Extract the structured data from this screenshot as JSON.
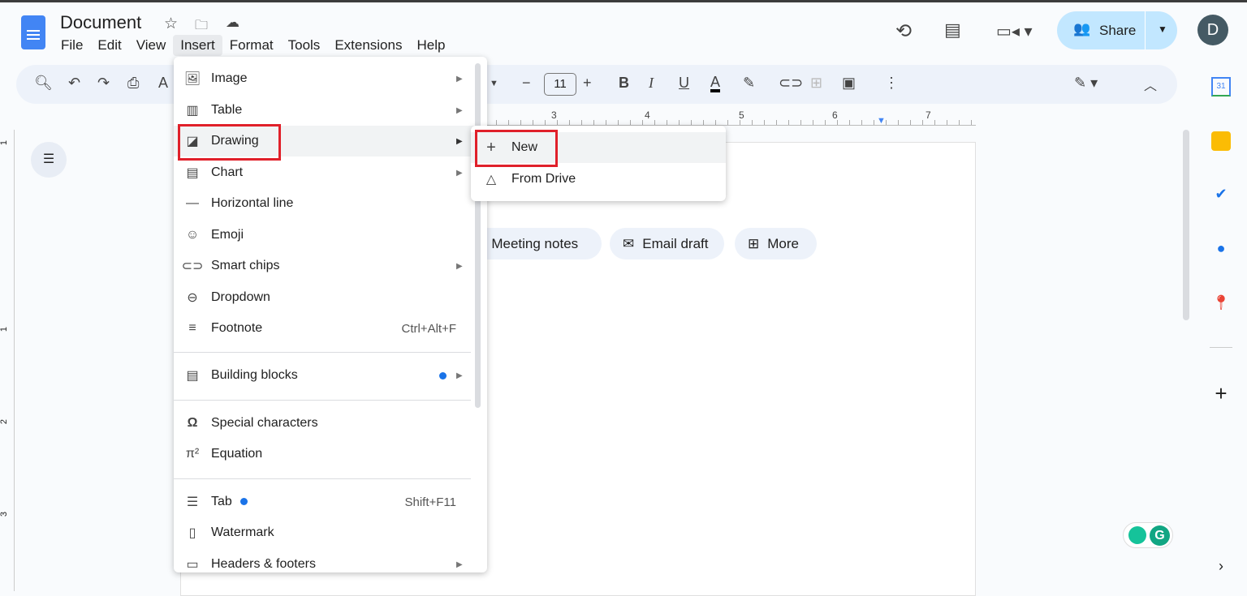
{
  "header": {
    "title": "Document",
    "avatar_letter": "D",
    "share_label": "Share"
  },
  "menubar": [
    "File",
    "Edit",
    "View",
    "Insert",
    "Format",
    "Tools",
    "Extensions",
    "Help"
  ],
  "toolbar": {
    "font_size": "11"
  },
  "ruler": {
    "labels": [
      "3",
      "4",
      "5",
      "6",
      "7"
    ],
    "vertical_labels": [
      "1",
      "1",
      "2",
      "3"
    ]
  },
  "chips": [
    {
      "label": "Meeting notes"
    },
    {
      "label": "Email draft"
    },
    {
      "label": "More"
    }
  ],
  "insert_menu": {
    "items": [
      {
        "label": "Image",
        "icon": "image-icon",
        "submenu": true
      },
      {
        "label": "Table",
        "icon": "table-icon",
        "submenu": true
      },
      {
        "label": "Drawing",
        "icon": "drawing-icon",
        "submenu": true
      },
      {
        "label": "Chart",
        "icon": "chart-icon",
        "submenu": true
      },
      {
        "label": "Horizontal line",
        "icon": "horizontal-line-icon"
      },
      {
        "label": "Emoji",
        "icon": "emoji-icon"
      },
      {
        "label": "Smart chips",
        "icon": "smart-chips-icon",
        "submenu": true
      },
      {
        "label": "Dropdown",
        "icon": "dropdown-icon"
      },
      {
        "label": "Footnote",
        "icon": "footnote-icon",
        "shortcut": "Ctrl+Alt+F"
      },
      {
        "label": "Building blocks",
        "icon": "building-blocks-icon",
        "submenu": true
      },
      {
        "label": "Special characters",
        "icon": "omega-icon"
      },
      {
        "label": "Equation",
        "icon": "pi-icon"
      },
      {
        "label": "Tab",
        "icon": "tab-icon",
        "shortcut": "Shift+F11"
      },
      {
        "label": "Watermark",
        "icon": "watermark-icon"
      },
      {
        "label": "Headers & footers",
        "icon": "headers-footers-icon",
        "submenu": true
      }
    ]
  },
  "drawing_submenu": {
    "items": [
      {
        "label": "New",
        "icon": "plus-icon"
      },
      {
        "label": "From Drive",
        "icon": "drive-icon"
      }
    ]
  },
  "colors": {
    "accent": "#1a73e8",
    "highlight_box": "#e0202a",
    "share_bg": "#c2e7ff"
  }
}
